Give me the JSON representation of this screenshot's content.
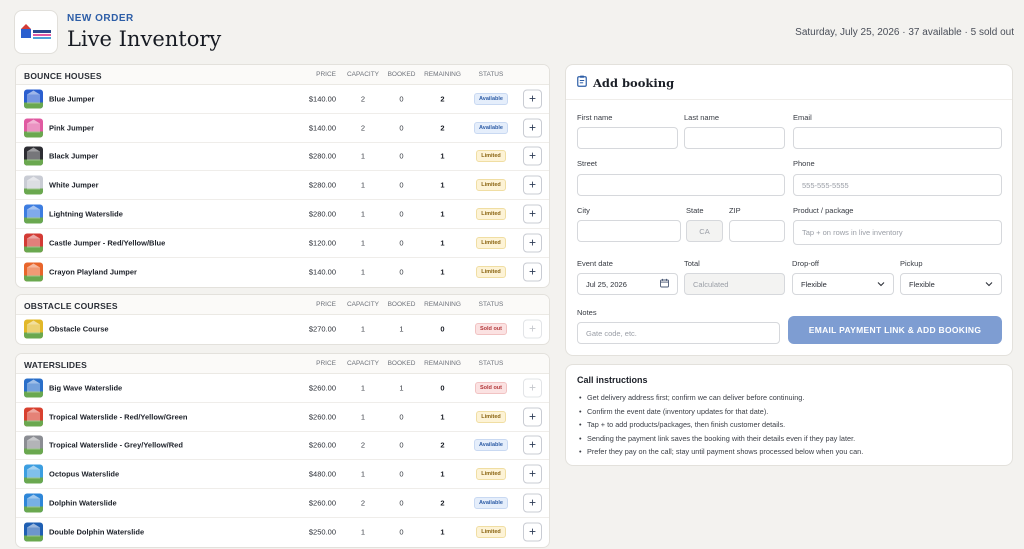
{
  "header": {
    "eyebrow": "NEW ORDER",
    "title": "Live Inventory",
    "summary": "Saturday, July 25, 2026 · 37 available · 5 sold out"
  },
  "columns": {
    "price": "PRICE",
    "capacity": "CAPACITY",
    "booked": "BOOKED",
    "remaining": "REMAINING",
    "status": "STATUS"
  },
  "sections": [
    {
      "title": "BOUNCE HOUSES",
      "items": [
        {
          "name": "Blue Jumper",
          "price": "$140.00",
          "capacity": "2",
          "booked": "0",
          "remaining": "2",
          "status": "Available",
          "status_key": "available",
          "thumb": "#2b5fcf"
        },
        {
          "name": "Pink Jumper",
          "price": "$140.00",
          "capacity": "2",
          "booked": "0",
          "remaining": "2",
          "status": "Available",
          "status_key": "available",
          "thumb": "#e05aa1"
        },
        {
          "name": "Black Jumper",
          "price": "$280.00",
          "capacity": "1",
          "booked": "0",
          "remaining": "1",
          "status": "Limited",
          "status_key": "limited",
          "thumb": "#2d2d33"
        },
        {
          "name": "White Jumper",
          "price": "$280.00",
          "capacity": "1",
          "booked": "0",
          "remaining": "1",
          "status": "Limited",
          "status_key": "limited",
          "thumb": "#c9ccd4"
        },
        {
          "name": "Lightning Waterslide",
          "price": "$280.00",
          "capacity": "1",
          "booked": "0",
          "remaining": "1",
          "status": "Limited",
          "status_key": "limited",
          "thumb": "#3d7de0"
        },
        {
          "name": "Castle Jumper - Red/Yellow/Blue",
          "price": "$120.00",
          "capacity": "1",
          "booked": "0",
          "remaining": "1",
          "status": "Limited",
          "status_key": "limited",
          "thumb": "#d33b35"
        },
        {
          "name": "Crayon Playland Jumper",
          "price": "$140.00",
          "capacity": "1",
          "booked": "0",
          "remaining": "1",
          "status": "Limited",
          "status_key": "limited",
          "thumb": "#e8652b"
        }
      ]
    },
    {
      "title": "OBSTACLE COURSES",
      "items": [
        {
          "name": "Obstacle Course",
          "price": "$270.00",
          "capacity": "1",
          "booked": "1",
          "remaining": "0",
          "status": "Sold out",
          "status_key": "soldout",
          "thumb": "#e2b829"
        }
      ]
    },
    {
      "title": "WATERSLIDES",
      "items": [
        {
          "name": "Big Wave Waterslide",
          "price": "$260.00",
          "capacity": "1",
          "booked": "1",
          "remaining": "0",
          "status": "Sold out",
          "status_key": "soldout",
          "thumb": "#2a6fc9"
        },
        {
          "name": "Tropical Waterslide - Red/Yellow/Green",
          "price": "$260.00",
          "capacity": "1",
          "booked": "0",
          "remaining": "1",
          "status": "Limited",
          "status_key": "limited",
          "thumb": "#d8402f"
        },
        {
          "name": "Tropical Waterslide - Grey/Yellow/Red",
          "price": "$260.00",
          "capacity": "2",
          "booked": "0",
          "remaining": "2",
          "status": "Available",
          "status_key": "available",
          "thumb": "#8b8d93"
        },
        {
          "name": "Octopus Waterslide",
          "price": "$480.00",
          "capacity": "1",
          "booked": "0",
          "remaining": "1",
          "status": "Limited",
          "status_key": "limited",
          "thumb": "#3c9ee0"
        },
        {
          "name": "Dolphin Waterslide",
          "price": "$260.00",
          "capacity": "2",
          "booked": "0",
          "remaining": "2",
          "status": "Available",
          "status_key": "available",
          "thumb": "#2e86d8"
        },
        {
          "name": "Double Dolphin Waterslide",
          "price": "$250.00",
          "capacity": "1",
          "booked": "0",
          "remaining": "1",
          "status": "Limited",
          "status_key": "limited",
          "thumb": "#1f5fb3"
        }
      ]
    }
  ],
  "booking": {
    "title": "Add booking",
    "first_name_label": "First name",
    "last_name_label": "Last name",
    "email_label": "Email",
    "street_label": "Street",
    "phone_label": "Phone",
    "phone_placeholder": "555-555-5555",
    "city_label": "City",
    "state_label": "State",
    "state_value": "CA",
    "zip_label": "ZIP",
    "product_label": "Product / package",
    "product_placeholder": "Tap + on rows in live inventory",
    "event_date_label": "Event date",
    "event_date_value": "Jul 25, 2026",
    "total_label": "Total",
    "total_placeholder": "Calculated",
    "dropoff_label": "Drop-off",
    "dropoff_value": "Flexible",
    "pickup_label": "Pickup",
    "pickup_value": "Flexible",
    "notes_label": "Notes",
    "notes_placeholder": "Gate code, etc.",
    "submit_label": "EMAIL PAYMENT LINK & ADD BOOKING"
  },
  "call": {
    "title": "Call instructions",
    "items": [
      "Get delivery address first; confirm we can deliver before continuing.",
      "Confirm the event date (inventory updates for that date).",
      "Tap + to add products/packages, then finish customer details.",
      "Sending the payment link saves the booking with their details even if they pay later.",
      "Prefer they pay on the call; stay until payment shows processed below when you can."
    ]
  },
  "colors": {
    "accent": "#2d5ea7",
    "submit": "#7e9dd2",
    "available": "#2f5da6",
    "limited": "#8a6412",
    "soldout": "#b2373a"
  },
  "icons": {
    "add": "+",
    "calendar": "calendar-icon",
    "chevron": "chevron-down-icon",
    "clipboard": "clipboard-icon"
  }
}
